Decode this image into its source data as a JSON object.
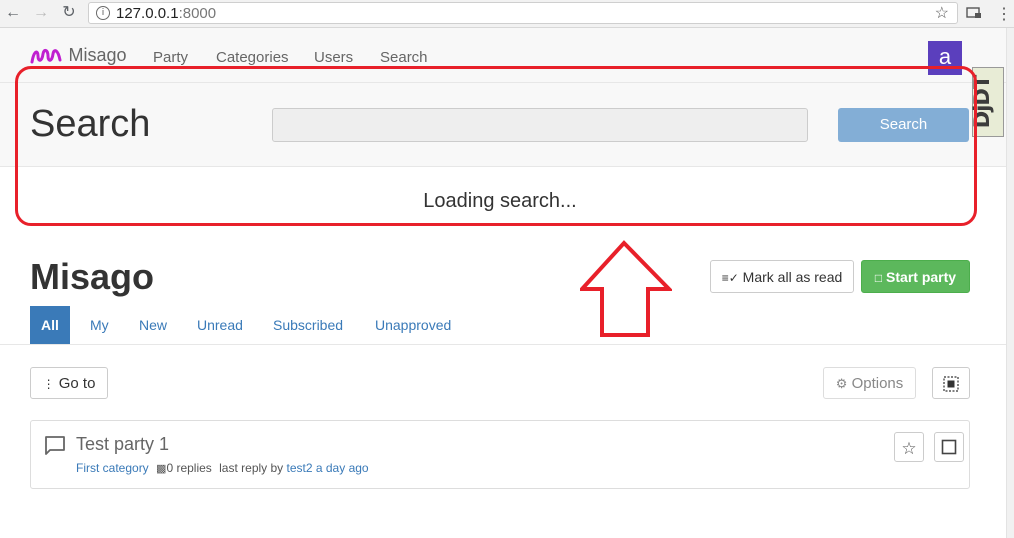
{
  "browser": {
    "url_host": "127.0.0.1",
    "url_port": ":8000"
  },
  "navbar": {
    "brand": "Misago",
    "links": [
      "Party",
      "Categories",
      "Users",
      "Search"
    ],
    "avatar_letter": "a"
  },
  "debug_toolbar": {
    "label": "DjDT"
  },
  "search": {
    "title": "Search",
    "button_label": "Search",
    "input_value": "",
    "loading_text": "Loading search..."
  },
  "forum": {
    "title": "Misago",
    "mark_read_label": "Mark all as read",
    "start_label": "Start party",
    "tabs": [
      "All",
      "My",
      "New",
      "Unread",
      "Subscribed",
      "Unapproved"
    ],
    "active_tab": "All",
    "goto_label": "Go to",
    "options_label": "Options"
  },
  "thread": {
    "title": "Test party 1",
    "category": "First category",
    "replies": "0 replies",
    "last_reply_prefix": "last reply by",
    "last_reply_user": "test2",
    "last_reply_time": "a day ago"
  },
  "colors": {
    "primary": "#3a7ab8",
    "success": "#5cb85c",
    "annotation": "#e8202a",
    "avatar": "#5b3fbd"
  }
}
